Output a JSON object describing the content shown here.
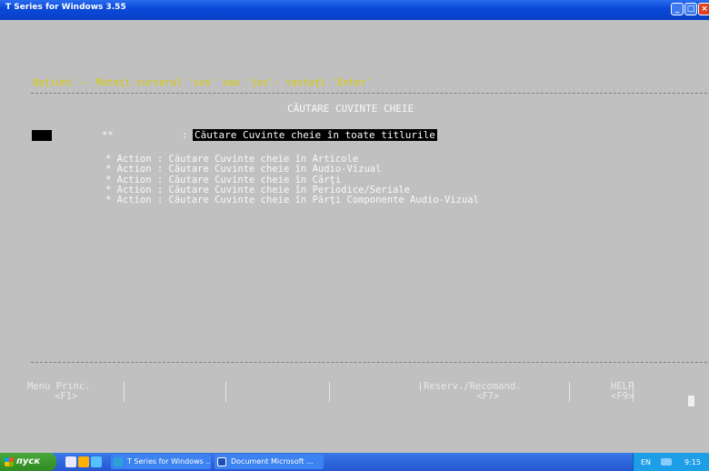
{
  "window": {
    "title": "T Series for Windows 3.55",
    "buttons": [
      "minimize",
      "maximize",
      "close"
    ]
  },
  "console": {
    "hint": "Opţiuni -- Mutaţi cursorul 'sus' sau 'jos'- tastaţi 'Enter'",
    "heading": "CĂUTARE CUVINTE CHEIE",
    "selected_row": {
      "marker": "**",
      "colon": ":",
      "label": "Căutare Cuvinte cheie în toate titlurile"
    },
    "options": [
      "* Action : Căutare Cuvinte cheie în Articole",
      "* Action : Căutare Cuvinte cheie în Audio-Vizual",
      "* Action : Căutare Cuvinte cheie în Cărţi",
      "* Action : Căutare Cuvinte cheie în Periodice/Seriale",
      "* Action : Căutare Cuvinte cheie în Părţi Componente Audio-Vizual"
    ],
    "function_keys": {
      "menu_label": "Menu Princ.",
      "menu_key": "<F1>",
      "reserv_label": "Reserv./Recomand.",
      "reserv_key": "<F7>",
      "help_label": "HELP",
      "help_key": "<F9>"
    }
  },
  "taskbar": {
    "start_label": "пуск",
    "tasks": [
      {
        "label": "T Series for Windows ...",
        "icon": "app-icon"
      },
      {
        "label": "Document Microsoft ...",
        "icon": "word-icon"
      }
    ],
    "tray_lang": "EN",
    "clock": "9:15"
  },
  "colors": {
    "console_bg": "#c0c0c0",
    "hint_text": "#d8cc00",
    "selection_bg": "#000000",
    "title_bar": "#0a4ad8",
    "taskbar": "#2456d0",
    "start_button": "#2e8a22"
  }
}
